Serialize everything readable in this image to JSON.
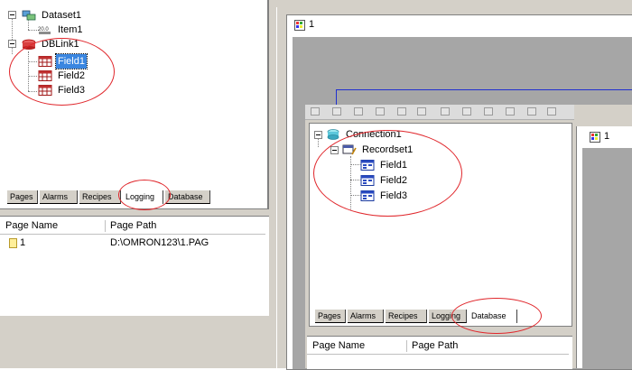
{
  "back_panel": {
    "tree": {
      "dataset": "Dataset1",
      "item": "Item1",
      "dblink": "DBLink1",
      "fields": [
        "Field1",
        "Field2",
        "Field3"
      ],
      "selected_field": "Field1"
    },
    "tabs": [
      "Pages",
      "Alarms",
      "Recipes",
      "Logging",
      "Database"
    ],
    "active_tab": "Logging",
    "table": {
      "columns": [
        "Page Name",
        "Page Path"
      ],
      "rows": [
        {
          "name": "1",
          "path": "D:\\OMRON123\\1.PAG"
        }
      ]
    },
    "page_window_title": "1"
  },
  "front_panel": {
    "tree": {
      "connection": "Connection1",
      "recordset": "Recordset1",
      "fields": [
        "Field1",
        "Field2",
        "Field3"
      ]
    },
    "tabs": [
      "Pages",
      "Alarms",
      "Recipes",
      "Logging",
      "Database"
    ],
    "active_tab": "Database",
    "table": {
      "columns": [
        "Page Name",
        "Page Path"
      ]
    },
    "page_window_title": "1"
  },
  "colors": {
    "annotation": "#e0262b",
    "selection": "#3a86e0",
    "window_gray": "#d4d0c8",
    "dark_gray": "#808080"
  }
}
